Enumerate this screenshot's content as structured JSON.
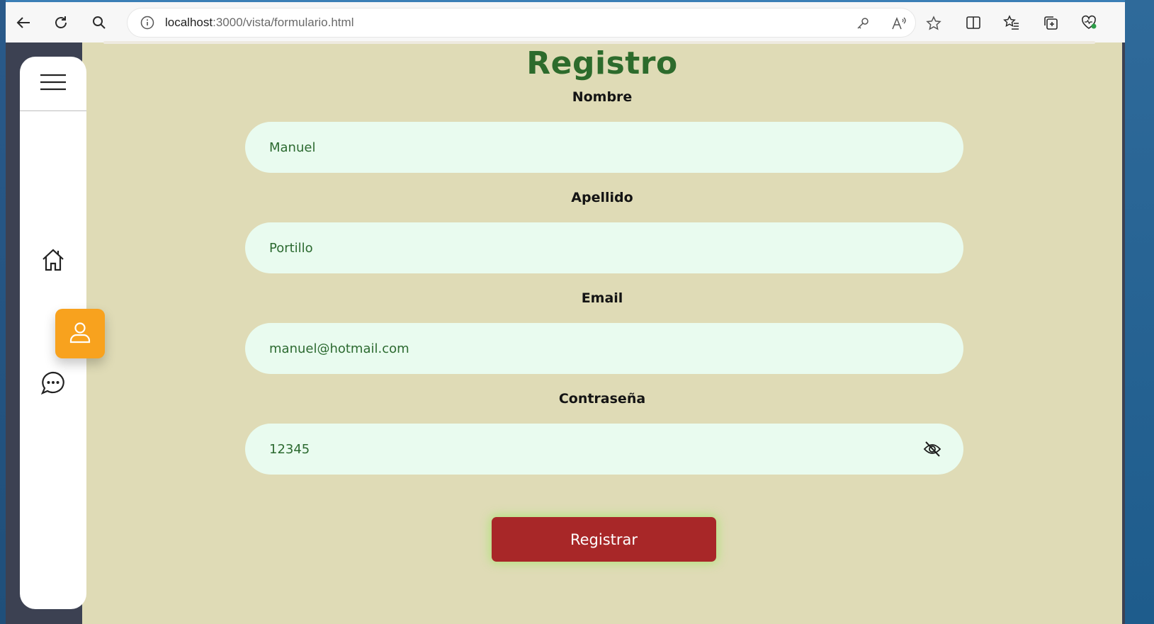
{
  "browser": {
    "url_host": "localhost",
    "url_path": ":3000/vista/formulario.html",
    "toolbar_icons": [
      "back-icon",
      "reload-icon",
      "search-icon",
      "site-info-icon",
      "key-icon",
      "read-aloud-icon",
      "favorite-star-icon",
      "split-screen-icon",
      "favorites-icon",
      "collections-icon",
      "browser-essentials-icon"
    ]
  },
  "sidebar": {
    "menu_icon": "hamburger-menu-icon",
    "items": [
      {
        "name": "home",
        "icon": "home-icon",
        "active": false
      },
      {
        "name": "profile",
        "icon": "user-icon",
        "active": true
      },
      {
        "name": "messages",
        "icon": "chat-icon",
        "active": false
      }
    ],
    "active_color": "#f8a21e"
  },
  "form": {
    "title": "Registro",
    "fields": [
      {
        "label": "Nombre",
        "value": "Manuel"
      },
      {
        "label": "Apellido",
        "value": "Portillo"
      },
      {
        "label": "Email",
        "value": "manuel@hotmail.com"
      },
      {
        "label": "Contraseña",
        "value": "12345",
        "toggle_icon": "eye-off-icon"
      }
    ],
    "submit_label": "Registrar"
  },
  "colors": {
    "page_bg": "#dfdbb6",
    "title": "#2d6b2c",
    "field_bg": "#e9fbef",
    "button_bg": "#a82728",
    "button_glow": "#96e65a"
  }
}
